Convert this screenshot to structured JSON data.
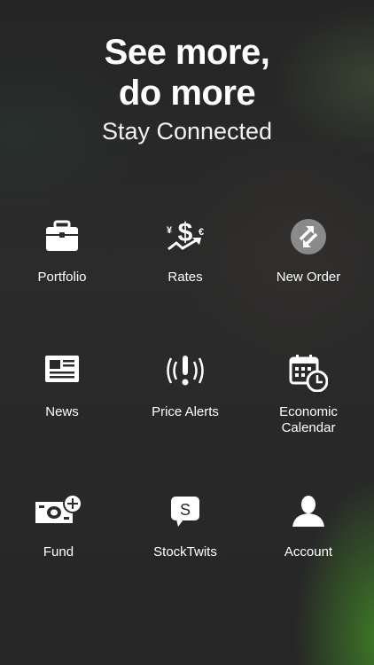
{
  "header": {
    "headline": "See more,\ndo more",
    "subtitle": "Stay Connected"
  },
  "menu": {
    "items": [
      {
        "label": "Portfolio",
        "icon": "briefcase-icon"
      },
      {
        "label": "Rates",
        "icon": "currency-rates-icon"
      },
      {
        "label": "New Order",
        "icon": "swap-arrows-icon"
      },
      {
        "label": "News",
        "icon": "newspaper-icon"
      },
      {
        "label": "Price Alerts",
        "icon": "alert-icon"
      },
      {
        "label": "Economic\nCalendar",
        "icon": "calendar-clock-icon"
      },
      {
        "label": "Fund",
        "icon": "cash-plus-icon"
      },
      {
        "label": "StockTwits",
        "icon": "stocktwits-icon"
      },
      {
        "label": "Account",
        "icon": "user-icon"
      }
    ]
  }
}
